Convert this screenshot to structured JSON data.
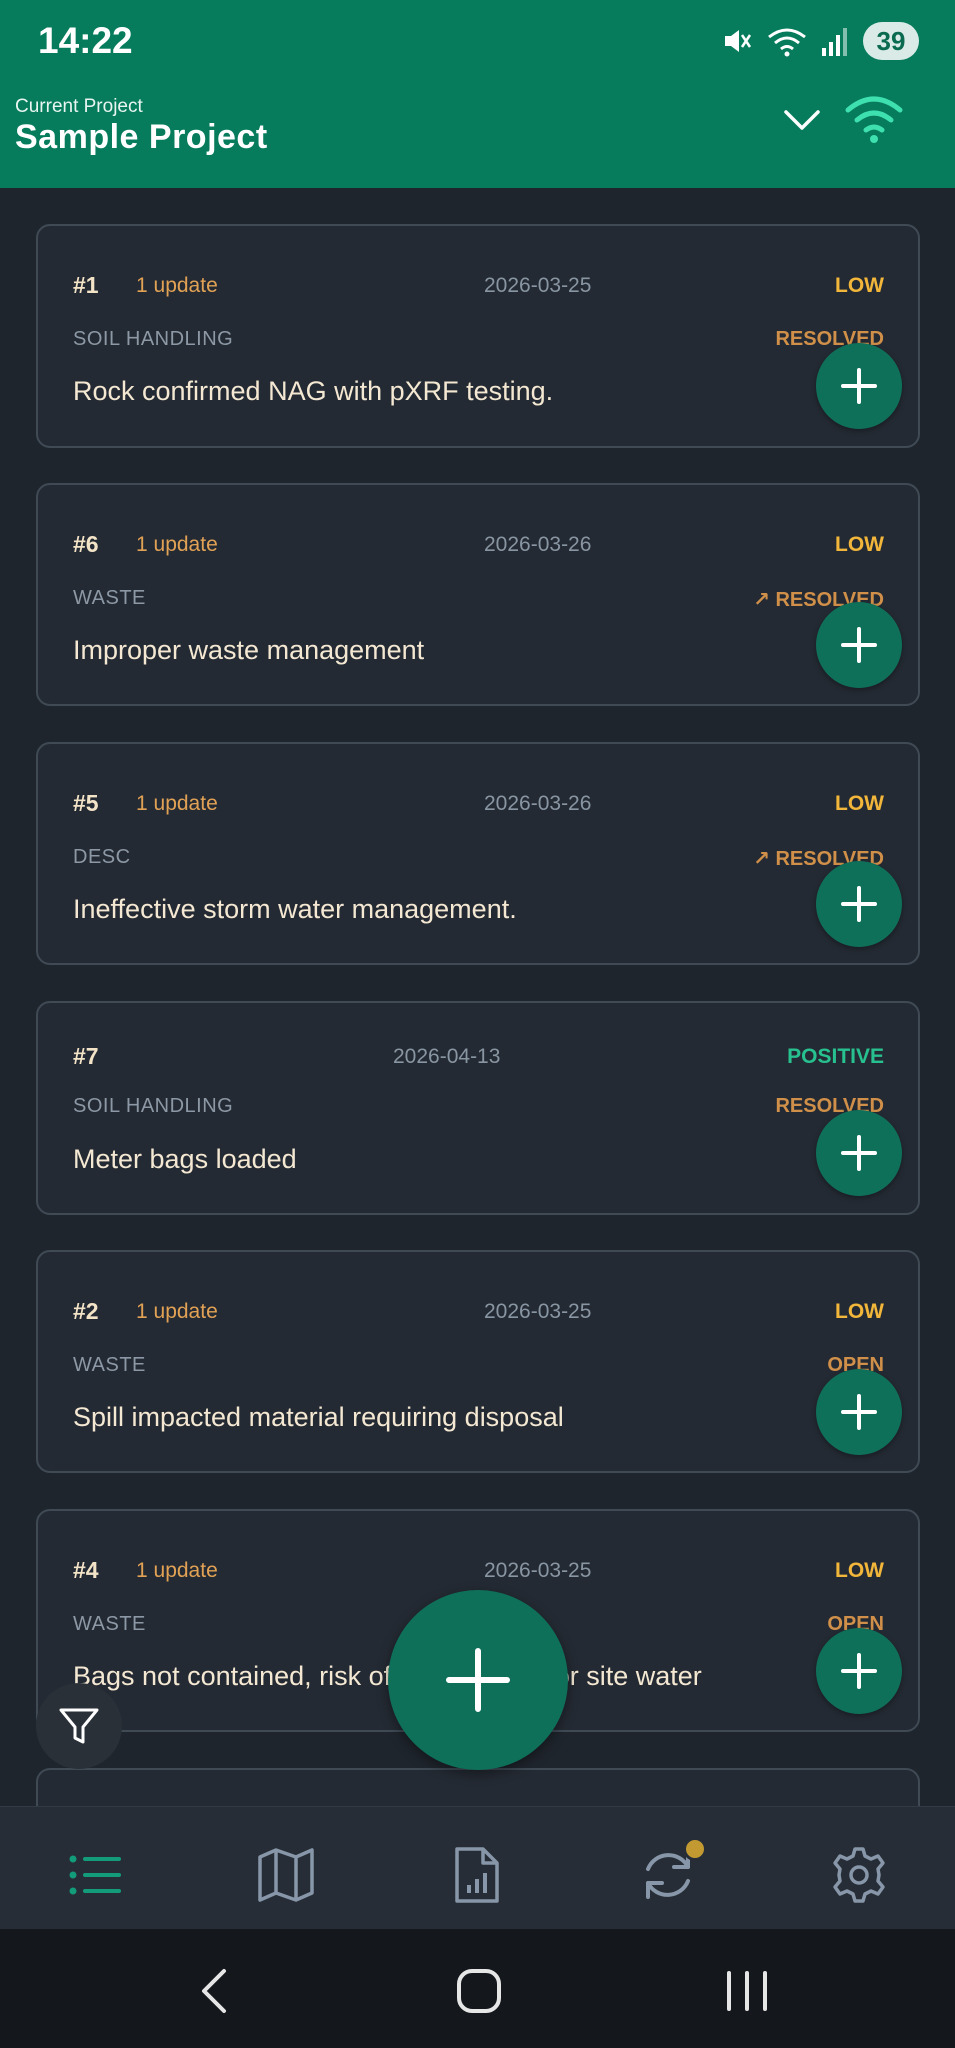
{
  "status_bar": {
    "time": "14:22",
    "battery": "39"
  },
  "header": {
    "label": "Current Project",
    "title": "Sample Project"
  },
  "cards": [
    {
      "num": "#1",
      "updates": "1 update",
      "date": "2026-03-25",
      "severity": "LOW",
      "category": "SOIL HANDLING",
      "status": "RESOLVED",
      "description": "Rock confirmed NAG with pXRF testing."
    },
    {
      "num": "#6",
      "updates": "1 update",
      "date": "2026-03-26",
      "severity": "LOW",
      "category": "WASTE",
      "status": "↗ RESOLVED",
      "description": "Improper waste management"
    },
    {
      "num": "#5",
      "updates": "1 update",
      "date": "2026-03-26",
      "severity": "LOW",
      "category": "DESC",
      "status": "↗ RESOLVED",
      "description": "Ineffective storm water management."
    },
    {
      "num": "#7",
      "updates": "",
      "date": "2026-04-13",
      "severity": "POSITIVE",
      "category": "SOIL HANDLING",
      "status": "RESOLVED",
      "description": "Meter bags loaded"
    },
    {
      "num": "#2",
      "updates": "1 update",
      "date": "2026-03-25",
      "severity": "LOW",
      "category": "WASTE",
      "status": "OPEN",
      "description": "Spill impacted material requiring disposal"
    },
    {
      "num": "#4",
      "updates": "1 update",
      "date": "2026-03-25",
      "severity": "LOW",
      "category": "WASTE",
      "status": "OPEN",
      "description": "Bags not contained, risk of implications for site water"
    }
  ],
  "colors": {
    "header": "#077c5d",
    "accent": "#0f705a",
    "low": "#f1b63a",
    "positive": "#27c08f",
    "status": "#d1904a"
  },
  "bottom_nav": [
    "list-icon",
    "map-icon",
    "report-icon",
    "sync-icon",
    "settings-icon"
  ]
}
